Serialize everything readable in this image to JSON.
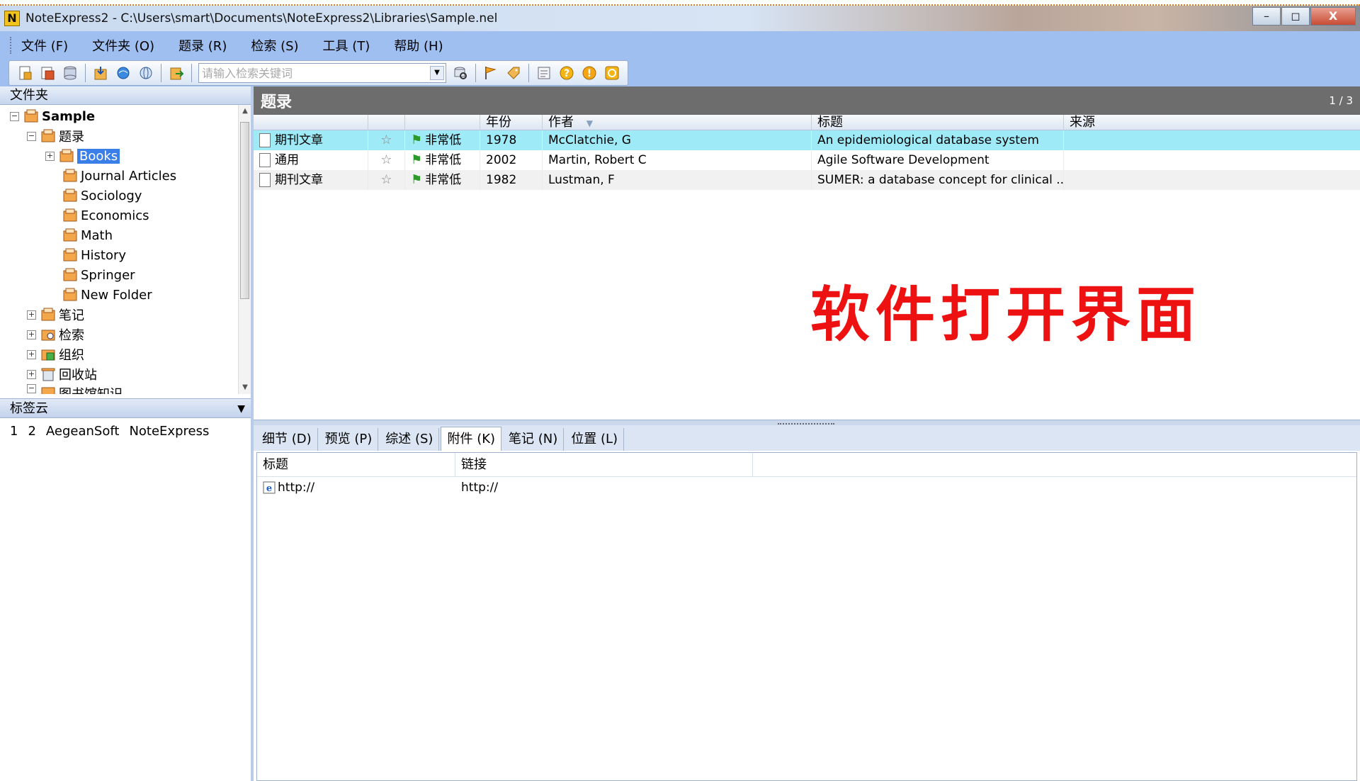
{
  "window": {
    "app_logo": "N",
    "title": "NoteExpress2 - C:\\Users\\smart\\Documents\\NoteExpress2\\Libraries\\Sample.nel",
    "btn_minimize": "–",
    "btn_restore": "◻",
    "btn_close": "X"
  },
  "menu": {
    "items": [
      "文件 (F)",
      "文件夹 (O)",
      "题录 (R)",
      "检索 (S)",
      "工具 (T)",
      "帮助 (H)"
    ]
  },
  "toolbar": {
    "search_placeholder": "请输入检索关键词"
  },
  "folders": {
    "header": "文件夹",
    "root": "Sample",
    "refs_node": "题录",
    "subfolders": [
      "Books",
      "Journal Articles",
      "Sociology",
      "Economics",
      "Math",
      "History",
      "Springer",
      "New Folder"
    ],
    "others": [
      "笔记",
      "检索",
      "组织",
      "回收站"
    ],
    "partial": "图书馆知识"
  },
  "tagcloud": {
    "header": "标签云",
    "tags": [
      "1",
      "2",
      "AegeanSoft",
      "NoteExpress"
    ]
  },
  "refs": {
    "title": "题录",
    "count": "1 / 3",
    "columns": [
      "",
      "",
      "",
      "年份",
      "作者",
      "标题",
      "来源"
    ],
    "rows": [
      {
        "type": "期刊文章",
        "priority": "非常低",
        "year": "1978",
        "author": "McClatchie, G",
        "title": "An epidemiological database system",
        "source": ""
      },
      {
        "type": "通用",
        "priority": "非常低",
        "year": "2002",
        "author": "Martin, Robert C",
        "title": "Agile Software Development",
        "source": ""
      },
      {
        "type": "期刊文章",
        "priority": "非常低",
        "year": "1982",
        "author": "Lustman, F",
        "title": "SUMER: a database concept for clinical ...",
        "source": ""
      }
    ]
  },
  "overlay": "软件打开界面",
  "tabs": [
    "细节 (D)",
    "预览 (P)",
    "综述 (S)",
    "附件 (K)",
    "笔记 (N)",
    "位置 (L)"
  ],
  "attachments": {
    "columns": [
      "标题",
      "链接"
    ],
    "rows": [
      {
        "title": "http://",
        "link": "http://"
      }
    ]
  },
  "colors": {
    "menubar_bg": "#9fbff0",
    "selected_row": "#9eeaf7",
    "overlay_text": "#ee1111",
    "tree_selection": "#3a7ee8"
  }
}
